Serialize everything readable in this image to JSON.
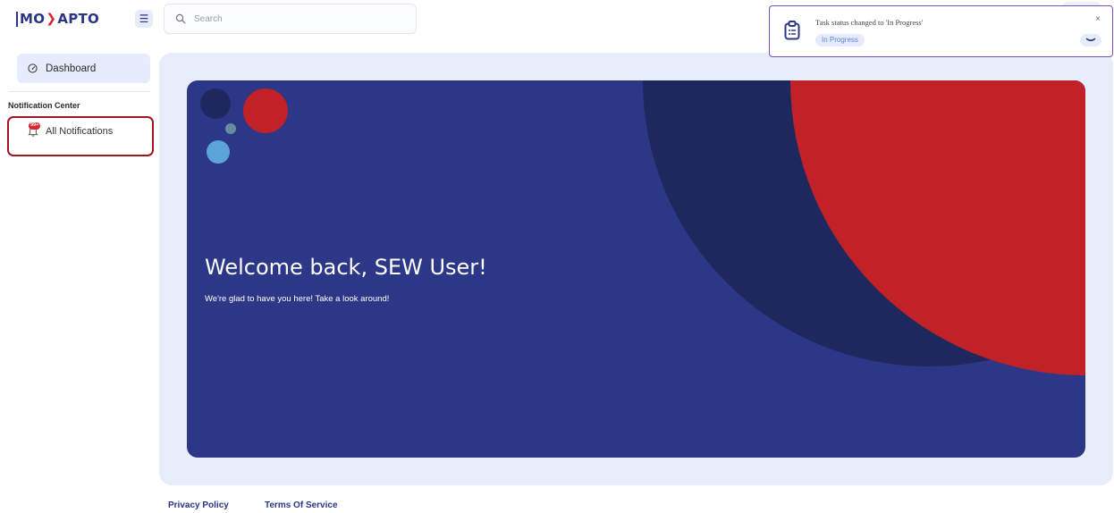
{
  "header": {
    "logo_left": "MO",
    "logo_right": "APTO",
    "search_placeholder": "Search"
  },
  "sidebar": {
    "dashboard_label": "Dashboard",
    "section_title": "Notification Center",
    "notifications_label": "All Notifications",
    "notifications_badge": "99+"
  },
  "hero": {
    "title": "Welcome back, SEW User!",
    "subtitle": "We're glad to have you here! Take a look around!"
  },
  "footer": {
    "privacy": "Privacy Policy",
    "terms": "Terms Of Service"
  },
  "toast": {
    "message": "Task status changed to 'In Progress'",
    "status": "In Progress",
    "close_symbol": "×"
  },
  "colors": {
    "brand_navy": "#2c3787",
    "brand_red": "#c12228",
    "highlight_border": "#a0151f",
    "toast_border": "#7b4fbf",
    "panel_bg": "#e8edfb"
  },
  "icons": {
    "menu": "menu-icon",
    "search": "search-icon",
    "dashboard": "dashboard-gauge-icon",
    "notifications": "bell-icon",
    "toast": "clipboard-list-icon",
    "toast_close": "close-icon",
    "toast_expand": "chevron-down-icon"
  }
}
